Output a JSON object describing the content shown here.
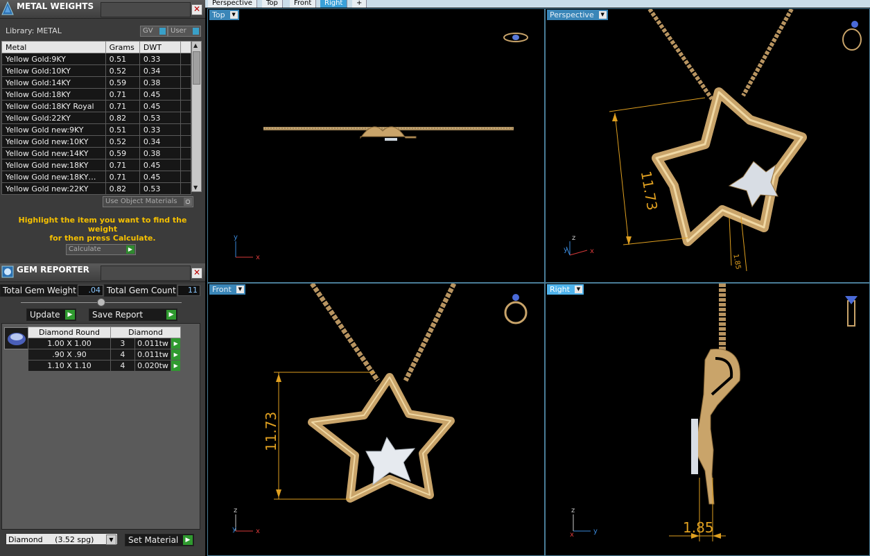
{
  "metal_weights": {
    "title": "METAL WEIGHTS",
    "close_label": "✕",
    "library_label": "Library: METAL",
    "toggle_gv": "GV",
    "toggle_user": "User",
    "columns": [
      "Metal",
      "Grams",
      "DWT"
    ],
    "rows": [
      [
        "Yellow Gold:9KY",
        "0.51",
        "0.33"
      ],
      [
        "Yellow Gold:10KY",
        "0.52",
        "0.34"
      ],
      [
        "Yellow Gold:14KY",
        "0.59",
        "0.38"
      ],
      [
        "Yellow Gold:18KY",
        "0.71",
        "0.45"
      ],
      [
        "Yellow Gold:18KY Royal",
        "0.71",
        "0.45"
      ],
      [
        "Yellow Gold:22KY",
        "0.82",
        "0.53"
      ],
      [
        "Yellow Gold new:9KY",
        "0.51",
        "0.33"
      ],
      [
        "Yellow Gold new:10KY",
        "0.52",
        "0.34"
      ],
      [
        "Yellow Gold new:14KY",
        "0.59",
        "0.38"
      ],
      [
        "Yellow Gold new:18KY",
        "0.71",
        "0.45"
      ],
      [
        "Yellow Gold new:18KY…",
        "0.71",
        "0.45"
      ],
      [
        "Yellow Gold new:22KY",
        "0.82",
        "0.53"
      ]
    ],
    "use_object_materials": "Use Object Materials",
    "hint_line1": "Highlight the item you want to find the weight",
    "hint_line2": "for then press Calculate.",
    "calculate_label": "Calculate"
  },
  "gem_reporter": {
    "title": "GEM REPORTER",
    "close_label": "✕",
    "total_weight_label": "Total Gem Weight",
    "total_weight_value": ".04",
    "total_count_label": "Total Gem Count",
    "total_count_value": "11",
    "update_label": "Update",
    "save_report_label": "Save Report",
    "table_header_shape": "Diamond Round",
    "table_header_material": "Diamond",
    "rows": [
      [
        "1.00 X 1.00",
        "3",
        "0.011tw"
      ],
      [
        ".90 X .90",
        "4",
        "0.011tw"
      ],
      [
        "1.10 X 1.10",
        "4",
        "0.020tw"
      ]
    ],
    "material_select": "Diamond     (3.52 spg)",
    "set_material_label": "Set Material"
  },
  "tabs": [
    "Perspective",
    "Top",
    "Front",
    "Right",
    "+"
  ],
  "active_tab": "Right",
  "viewports": {
    "top": {
      "label": "Top"
    },
    "perspective": {
      "label": "Perspective",
      "dimension_main": "11.73",
      "dimension_small": "1.85"
    },
    "front": {
      "label": "Front",
      "dimension": "11.73"
    },
    "right": {
      "label": "Right",
      "dimension": "1.85"
    }
  },
  "axes": {
    "x": "x",
    "y": "y",
    "z": "z"
  },
  "colors": {
    "gold": "#c9a46a",
    "panel_bg": "#3b3b3b",
    "viewport_label": "#3a86b8",
    "hint_text": "#f5c000",
    "dimension": "#e0a020"
  }
}
